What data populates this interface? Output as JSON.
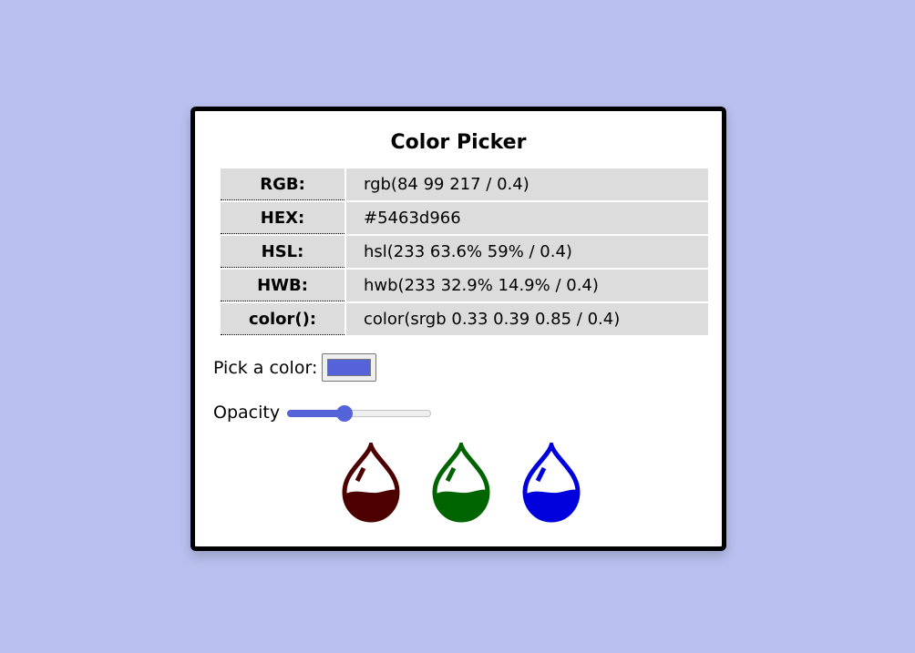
{
  "page": {
    "background_color": "#b9c0ef"
  },
  "card": {
    "title": "Color Picker"
  },
  "values": [
    {
      "label": "RGB:",
      "value": "rgb(84 99 217 / 0.4)"
    },
    {
      "label": "HEX:",
      "value": "#5463d966"
    },
    {
      "label": "HSL:",
      "value": "hsl(233 63.6% 59% / 0.4)"
    },
    {
      "label": "HWB:",
      "value": "hwb(233 32.9% 14.9% / 0.4)"
    },
    {
      "label": "color():",
      "value": "color(srgb 0.33 0.39 0.85 / 0.4)"
    }
  ],
  "picker": {
    "label": "Pick a color:",
    "selected_color": "#5463d9"
  },
  "opacity": {
    "label": "Opacity",
    "value": 0.4
  },
  "drops": [
    {
      "name": "red",
      "color": "#4d0000",
      "icon": "water-drop-icon"
    },
    {
      "name": "green",
      "color": "#006400",
      "icon": "water-drop-icon"
    },
    {
      "name": "blue",
      "color": "#0000dc",
      "icon": "water-drop-icon"
    }
  ]
}
